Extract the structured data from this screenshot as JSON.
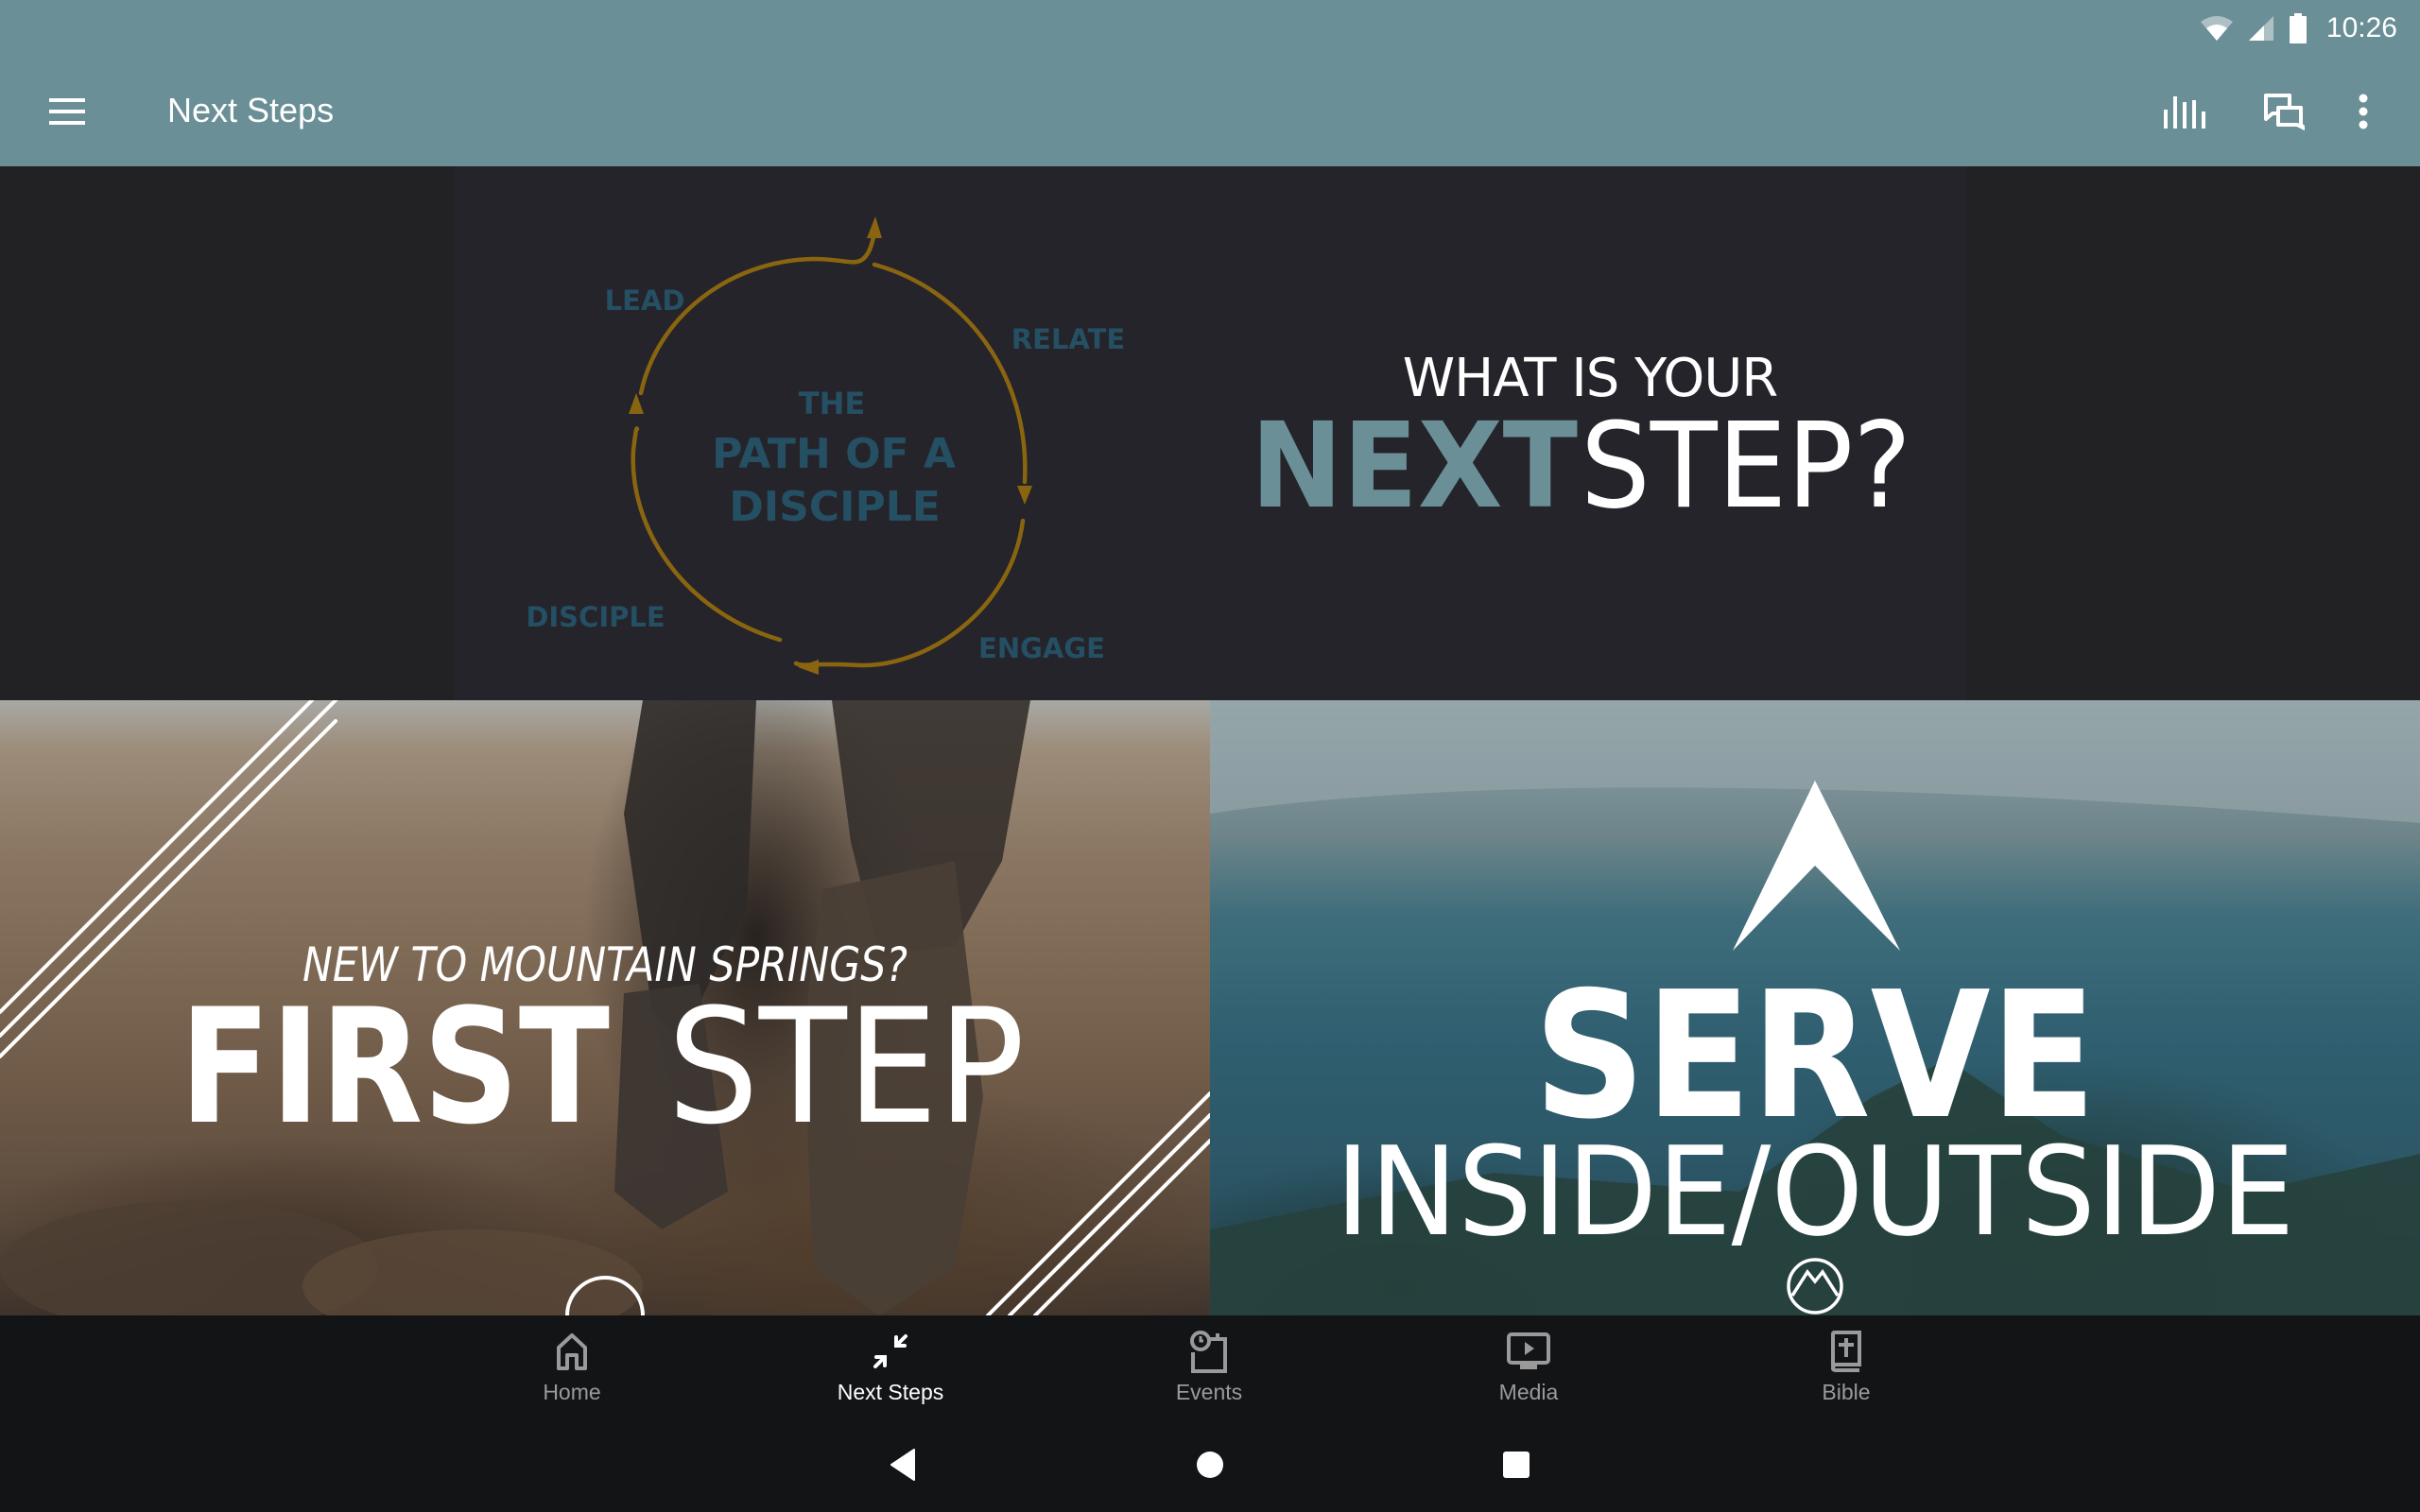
{
  "status_bar": {
    "time": "10:26",
    "icons": [
      "wifi-icon",
      "cell-signal-icon",
      "battery-icon"
    ]
  },
  "app_bar": {
    "title": "Next Steps",
    "menu_icon": "hamburger-menu-icon",
    "actions": [
      {
        "name": "audio-bars-icon",
        "label": "Audio"
      },
      {
        "name": "chat-icon",
        "label": "Chat"
      },
      {
        "name": "overflow-menu-icon",
        "label": "More options"
      }
    ]
  },
  "banner": {
    "diagram": {
      "center_line1": "THE",
      "center_line2": "PATH OF A",
      "center_line3": "DISCIPLE",
      "labels": [
        "LEAD",
        "RELATE",
        "ENGAGE",
        "DISCIPLE"
      ]
    },
    "headline_top": "WHAT IS YOUR",
    "headline_bold": "NEXT",
    "headline_light": "STEP?",
    "colors": {
      "accent": "#6a8f96",
      "diagram_text": "#254f63",
      "circle": "#8a6510",
      "background": "#25242b"
    }
  },
  "cards": [
    {
      "id": "first-step",
      "subtitle": "NEW TO MOUNTAIN SPRINGS?",
      "title_bold": "FIRST",
      "title_light": "STEP"
    },
    {
      "id": "serve",
      "title_bold": "SERVE",
      "title_light": "INSIDE/OUTSIDE"
    }
  ],
  "bottom_nav": {
    "active": "Next Steps",
    "items": [
      {
        "label": "Home",
        "icon": "home-icon"
      },
      {
        "label": "Next Steps",
        "icon": "next-steps-icon"
      },
      {
        "label": "Events",
        "icon": "events-icon"
      },
      {
        "label": "Media",
        "icon": "media-icon"
      },
      {
        "label": "Bible",
        "icon": "bible-icon"
      }
    ]
  },
  "system_nav": {
    "buttons": [
      "back",
      "home",
      "recents"
    ]
  }
}
